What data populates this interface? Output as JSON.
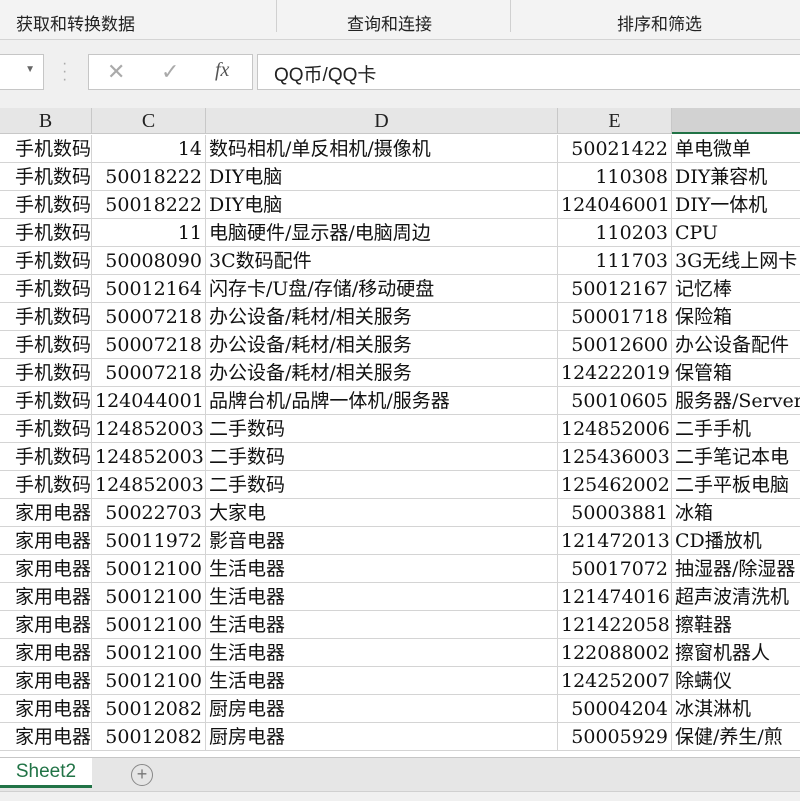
{
  "ribbon": {
    "groups": [
      "获取和转换数据",
      "查询和连接",
      "排序和筛选"
    ]
  },
  "formula_bar": {
    "cancel_icon": "✕",
    "enter_icon": "✓",
    "fx_label": "fx",
    "value": "QQ币/QQ卡"
  },
  "columns": [
    "B",
    "C",
    "D",
    "E",
    ""
  ],
  "selected_column_index": 4,
  "rows": [
    [
      "手机数码",
      "14",
      "数码相机/单反相机/摄像机",
      "50021422",
      "单电微单"
    ],
    [
      "手机数码",
      "50018222",
      "DIY电脑",
      "110308",
      "DIY兼容机"
    ],
    [
      "手机数码",
      "50018222",
      "DIY电脑",
      "124046001",
      "DIY一体机"
    ],
    [
      "手机数码",
      "11",
      "电脑硬件/显示器/电脑周边",
      "110203",
      "CPU"
    ],
    [
      "手机数码",
      "50008090",
      "3C数码配件",
      "111703",
      "3G无线上网卡"
    ],
    [
      "手机数码",
      "50012164",
      "闪存卡/U盘/存储/移动硬盘",
      "50012167",
      "记忆棒"
    ],
    [
      "手机数码",
      "50007218",
      "办公设备/耗材/相关服务",
      "50001718",
      "保险箱"
    ],
    [
      "手机数码",
      "50007218",
      "办公设备/耗材/相关服务",
      "50012600",
      "办公设备配件"
    ],
    [
      "手机数码",
      "50007218",
      "办公设备/耗材/相关服务",
      "124222019",
      "保管箱"
    ],
    [
      "手机数码",
      "124044001",
      "品牌台机/品牌一体机/服务器",
      "50010605",
      "服务器/Server"
    ],
    [
      "手机数码",
      "124852003",
      "二手数码",
      "124852006",
      "二手手机"
    ],
    [
      "手机数码",
      "124852003",
      "二手数码",
      "125436003",
      "二手笔记本电"
    ],
    [
      "手机数码",
      "124852003",
      "二手数码",
      "125462002",
      "二手平板电脑"
    ],
    [
      "家用电器",
      "50022703",
      "大家电",
      "50003881",
      "冰箱"
    ],
    [
      "家用电器",
      "50011972",
      "影音电器",
      "121472013",
      "CD播放机"
    ],
    [
      "家用电器",
      "50012100",
      "生活电器",
      "50017072",
      "抽湿器/除湿器"
    ],
    [
      "家用电器",
      "50012100",
      "生活电器",
      "121474016",
      "超声波清洗机"
    ],
    [
      "家用电器",
      "50012100",
      "生活电器",
      "121422058",
      "擦鞋器"
    ],
    [
      "家用电器",
      "50012100",
      "生活电器",
      "122088002",
      "擦窗机器人"
    ],
    [
      "家用电器",
      "50012100",
      "生活电器",
      "124252007",
      "除螨仪"
    ],
    [
      "家用电器",
      "50012082",
      "厨房电器",
      "50004204",
      "冰淇淋机"
    ],
    [
      "家用电器",
      "50012082",
      "厨房电器",
      "50005929",
      "保健/养生/煎"
    ]
  ],
  "sheet_tabs": {
    "active": "Sheet2",
    "add_icon": "+"
  },
  "colors": {
    "accent": "#217346"
  }
}
